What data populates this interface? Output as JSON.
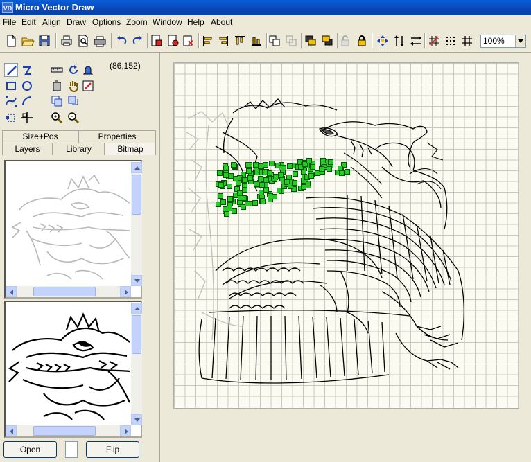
{
  "window": {
    "app_icon": "VD",
    "title": "Micro Vector Draw"
  },
  "menu": [
    "File",
    "Edit",
    "Align",
    "Draw",
    "Options",
    "Zoom",
    "Window",
    "Help",
    "About"
  ],
  "toolbar": {
    "zoom_value": "100%",
    "buttons": [
      "new-icon",
      "open-icon",
      "save-icon",
      "print-icon",
      "print-preview-icon",
      "printer-setup-icon",
      "undo-icon",
      "redo-icon",
      "import-icon",
      "export-icon",
      "clipboard-icon",
      "align-left-icon",
      "align-right-icon",
      "align-top-icon",
      "align-bottom-icon",
      "group-icon",
      "ungroup-icon",
      "bring-front-icon",
      "send-back-icon",
      "unlock-icon",
      "lock-icon",
      "move-center-icon",
      "flip-vertical-icon",
      "flip-horizontal-icon",
      "snap-icon",
      "grid-dots-icon",
      "grid-lines-icon"
    ]
  },
  "tools": {
    "coords": "(86,152)"
  },
  "tabs": {
    "row1": [
      "Size+Pos",
      "Properties"
    ],
    "row2": [
      "Layers",
      "Library",
      "Bitmap"
    ],
    "selected": "Bitmap"
  },
  "buttons": {
    "open": "Open",
    "flip": "Flip"
  },
  "colors": {
    "accent": "#0a5fd8",
    "selection": "#22cc22",
    "canvas": "#fcfbf1"
  }
}
